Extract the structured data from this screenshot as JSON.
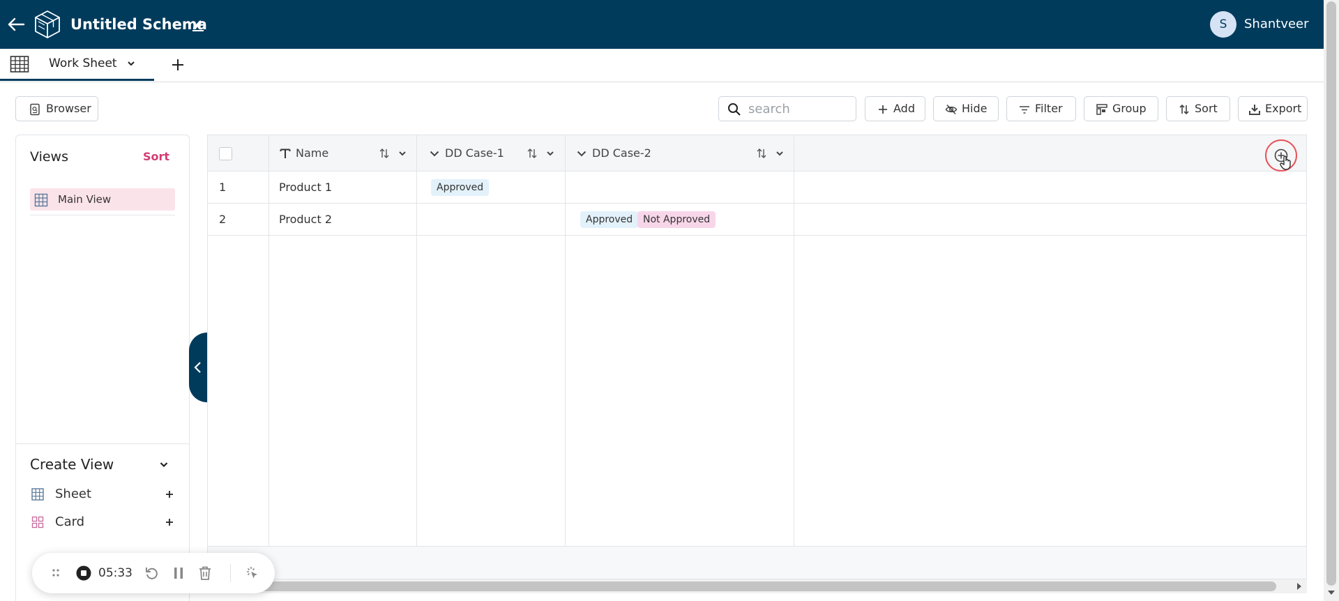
{
  "header": {
    "title": "Untitled Schema",
    "user_initial": "S",
    "user_name": "Shantveer"
  },
  "tabs": [
    {
      "label": "Work Sheet"
    }
  ],
  "toolbar": {
    "browser_label": "Browser",
    "search_placeholder": "search",
    "add_label": "Add",
    "hide_label": "Hide",
    "filter_label": "Filter",
    "group_label": "Group",
    "sort_label": "Sort",
    "export_label": "Export"
  },
  "views_panel": {
    "title": "Views",
    "sort_label": "Sort",
    "views": [
      {
        "label": "Main View"
      }
    ],
    "create_view_title": "Create View",
    "create_options": [
      {
        "label": "Sheet"
      },
      {
        "label": "Card"
      }
    ]
  },
  "grid": {
    "columns": [
      {
        "label": "Name",
        "type_icon": "text-type-icon"
      },
      {
        "label": "DD Case-1",
        "type_icon": "dropdown-type-icon"
      },
      {
        "label": "DD Case-2",
        "type_icon": "dropdown-type-icon"
      }
    ],
    "rows": [
      {
        "index": "1",
        "name": "Product 1",
        "dd1": [
          "Approved"
        ],
        "dd2": []
      },
      {
        "index": "2",
        "name": "Product 2",
        "dd1": [],
        "dd2": [
          "Approved",
          "Not Approved"
        ]
      }
    ]
  },
  "recorder": {
    "time": "05:33"
  },
  "colors": {
    "header_bg": "#013b5c",
    "accent_pink": "#d33d72",
    "chip_blue": "#e3f1fb",
    "chip_pink": "#f8d6ea",
    "highlight_ring": "#e8525a"
  }
}
